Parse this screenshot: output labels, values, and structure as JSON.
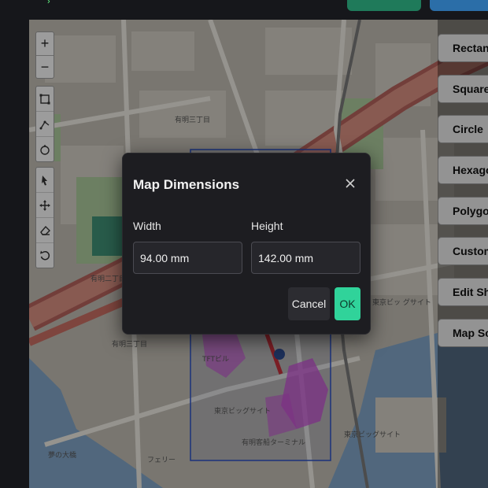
{
  "dialog": {
    "title": "Map Dimensions",
    "width_label": "Width",
    "height_label": "Height",
    "width_value": "94.00 mm",
    "height_value": "142.00 mm",
    "cancel_label": "Cancel",
    "ok_label": "OK",
    "close_glyph": "×"
  },
  "map_controls": {
    "zoom_in": "+",
    "zoom_out": "−",
    "draw_tools": [
      "rectangle-icon",
      "line-icon",
      "circle-icon"
    ],
    "edit_tools": [
      "pointer-icon",
      "move-icon",
      "eraser-icon",
      "undo-icon"
    ]
  },
  "side_panel": {
    "buttons": [
      "Rectang",
      "Square",
      "Circle",
      "Hexago",
      "Polygon",
      "Custom S",
      "Edit Shap",
      "Map Sca"
    ]
  },
  "map_labels": {
    "district_1": "有明三丁目",
    "district_2": "有明二丁目",
    "district_3": "有明三丁目",
    "station": "東京ビッグサイト",
    "venue": "TFTビル",
    "station_2": "東京ビッグサイト",
    "terminal": "有明客船ターミナル",
    "park": "夢の大橋",
    "bridge": "フェリー",
    "hall": "東京ビッ グサイト"
  },
  "colors": {
    "ok_button": "#30d39a",
    "dialog_bg": "#1d1d21",
    "selection_frame": "#2a4fc0",
    "shape_fill": "#c24bd0",
    "marker": "#c0303a"
  }
}
